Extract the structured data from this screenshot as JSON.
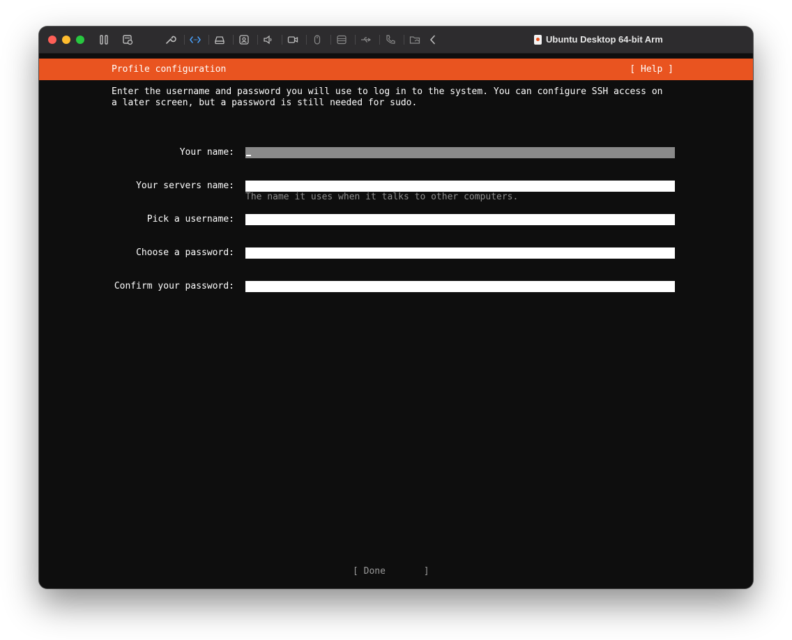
{
  "window": {
    "title": "Ubuntu Desktop 64-bit Arm",
    "toolbar_icons": [
      "pause-icon",
      "snapshot-icon",
      "wrench-icon",
      "code-icon",
      "drive-icon",
      "camera-user-icon",
      "speaker-icon",
      "video-camera-icon",
      "mouse-icon",
      "hard-disk-icon",
      "usb-icon",
      "phone-icon",
      "shared-folder-icon",
      "chevron-left-icon"
    ]
  },
  "installer": {
    "header_title": "Profile configuration",
    "help_label": "[ Help ]",
    "intro": "Enter the username and password you will use to log in to the system. You can configure SSH access on\na later screen, but a password is still needed for sudo.",
    "fields": {
      "name": {
        "label": "Your name:",
        "value": ""
      },
      "server": {
        "label": "Your servers name:",
        "value": "",
        "hint": "The name it uses when it talks to other computers."
      },
      "username": {
        "label": "Pick a username:",
        "value": ""
      },
      "password": {
        "label": "Choose a password:",
        "value": ""
      },
      "confirm": {
        "label": "Confirm your password:",
        "value": ""
      }
    },
    "done_label": "[ Done       ]"
  },
  "colors": {
    "accent": "#E95420",
    "background": "#0E0E0E",
    "focused_field": "#8A8A8A"
  }
}
